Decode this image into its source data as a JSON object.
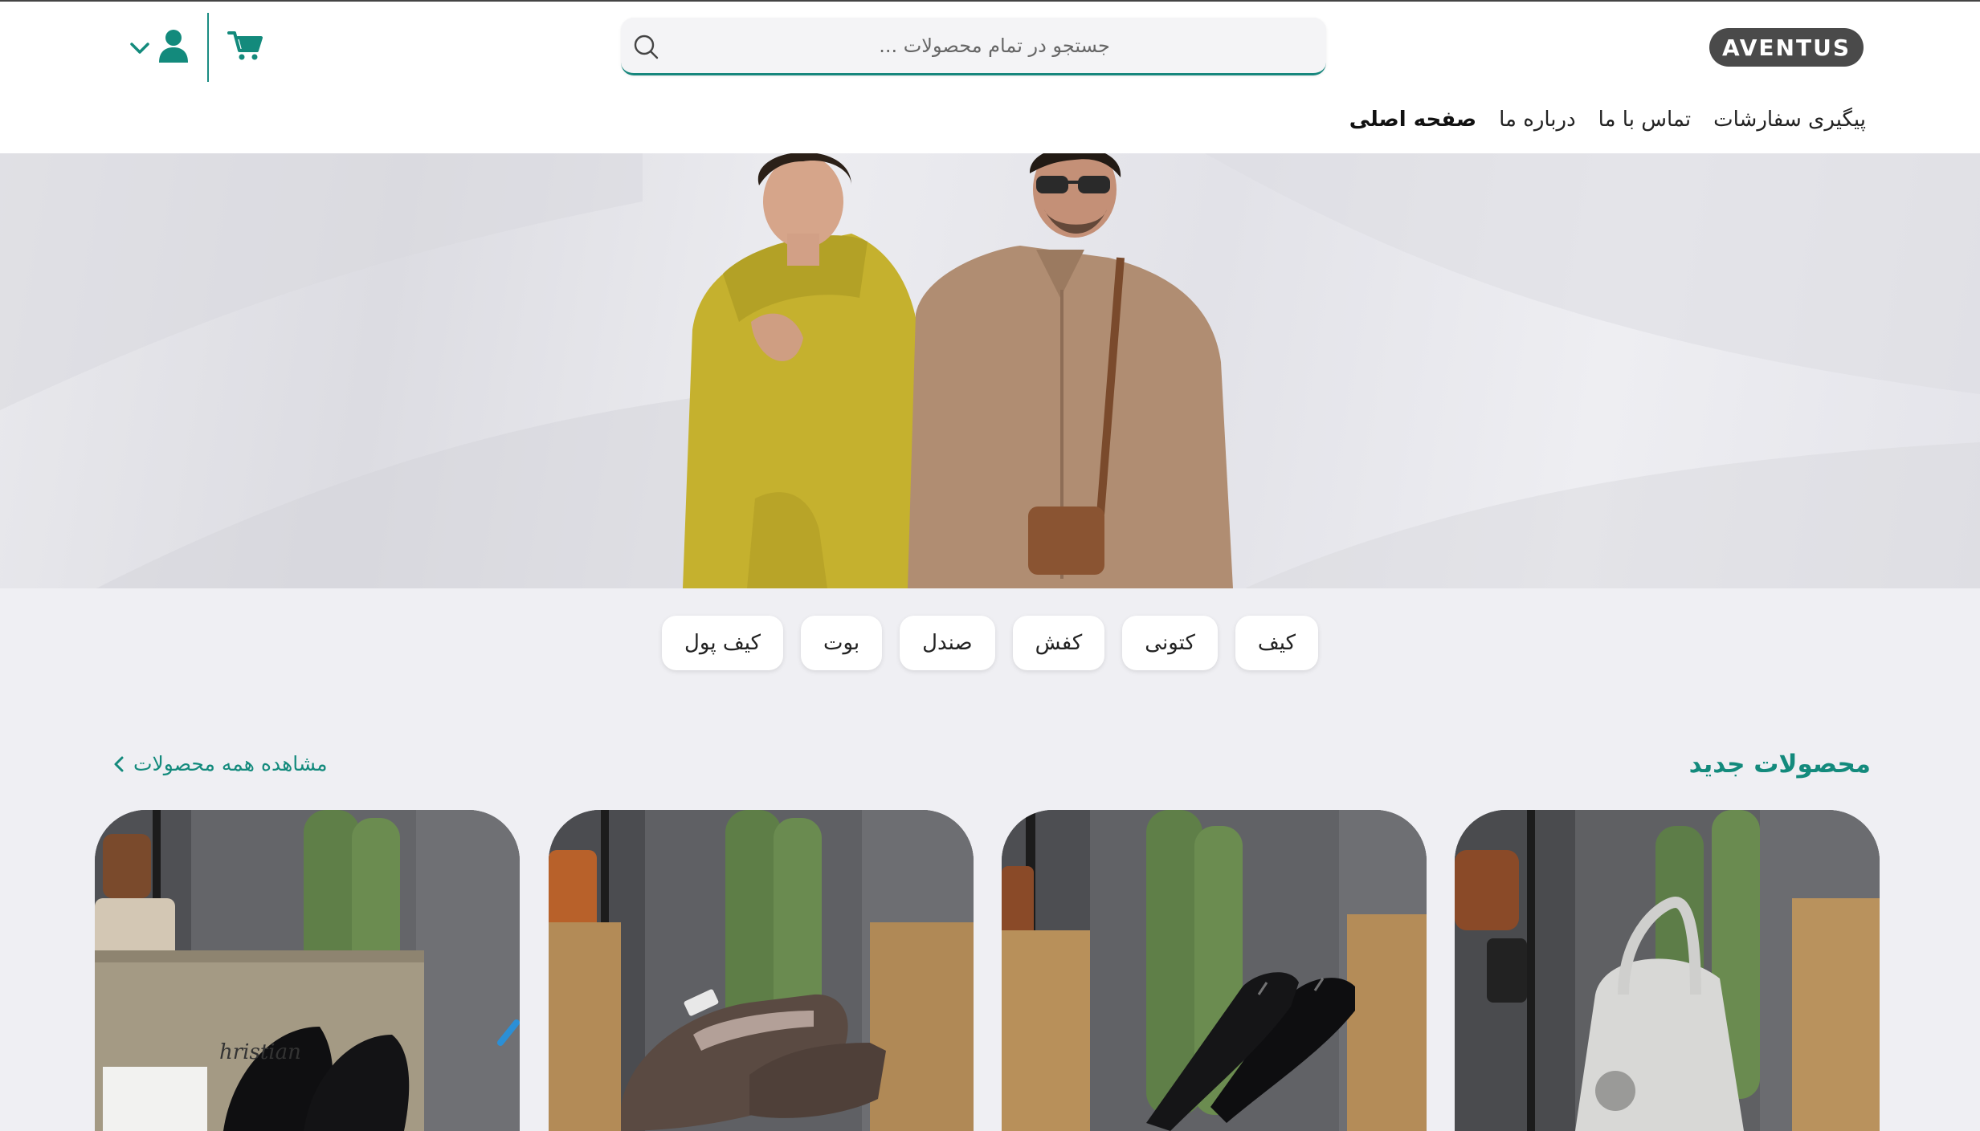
{
  "brand": {
    "logo_text": "AVENTUS",
    "accent_color": "#138a7c"
  },
  "search": {
    "placeholder": "جستجو در تمام محصولات ..."
  },
  "header_icons": [
    "search-icon",
    "cart-icon",
    "user-icon",
    "chevron-down-icon"
  ],
  "nav": {
    "items": [
      {
        "label": "صفحه اصلی",
        "active": true
      },
      {
        "label": "درباره ما",
        "active": false
      },
      {
        "label": "تماس با ما",
        "active": false
      },
      {
        "label": "پیگیری سفارشات",
        "active": false
      }
    ]
  },
  "categories": [
    "کیف",
    "کتونی",
    "کفش",
    "صندل",
    "بوت",
    "کیف پول"
  ],
  "section": {
    "title": "محصولات جدید",
    "view_all": "مشاهده همه محصولات"
  },
  "products": [
    {
      "image": "white-handbag-photo"
    },
    {
      "image": "black-heels-photo"
    },
    {
      "image": "brown-sneakers-photo"
    },
    {
      "image": "black-pumps-box-photo"
    }
  ]
}
